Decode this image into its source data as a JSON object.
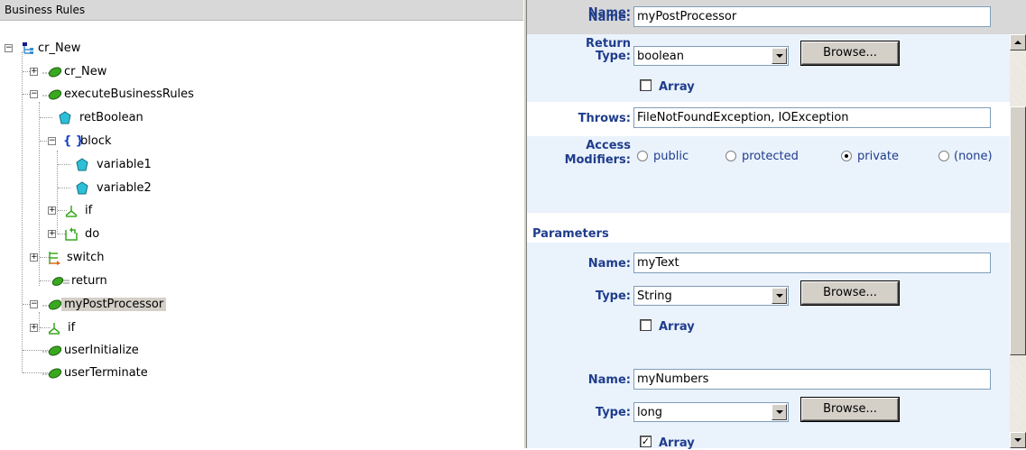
{
  "left_pane": {
    "header": "Business Rules",
    "tree": [
      {
        "label": "cr_New",
        "icon": "class-icon"
      },
      {
        "label": "cr_New",
        "icon": "method-icon"
      },
      {
        "label": "executeBusinessRules",
        "icon": "method-icon"
      },
      {
        "label": "retBoolean",
        "icon": "variable-icon"
      },
      {
        "label": "block",
        "icon": "block-icon",
        "icon_text": "{ }"
      },
      {
        "label": "variable1",
        "icon": "variable-icon"
      },
      {
        "label": "variable2",
        "icon": "variable-icon"
      },
      {
        "label": "if",
        "icon": "if-icon"
      },
      {
        "label": "do",
        "icon": "do-icon"
      },
      {
        "label": "switch",
        "icon": "switch-icon"
      },
      {
        "label": "return",
        "icon": "return-icon"
      },
      {
        "label": "myPostProcessor",
        "icon": "method-icon",
        "selected": true
      },
      {
        "label": "if",
        "icon": "if-icon"
      },
      {
        "label": "userInitialize",
        "icon": "method-icon"
      },
      {
        "label": "userTerminate",
        "icon": "method-icon"
      }
    ]
  },
  "method": {
    "name_label": "Name:",
    "name_value": "myPostProcessor",
    "return_type_label_1": "Return",
    "return_type_label_2": "Type:",
    "return_type_value": "boolean",
    "browse_label": "Browse...",
    "array_label": "Array",
    "array_checked": false,
    "throws_label": "Throws:",
    "throws_value": "FileNotFoundException, IOException",
    "access_label_1": "Access",
    "access_label_2": "Modifiers:",
    "access_options": [
      "public",
      "protected",
      "private",
      "(none)"
    ],
    "access_selected": "private"
  },
  "parameters": {
    "section_label": "Parameters",
    "items": [
      {
        "name_label": "Name:",
        "name": "myText",
        "type_label": "Type:",
        "type": "String",
        "browse_label": "Browse...",
        "array_label": "Array",
        "array_checked": false
      },
      {
        "name_label": "Name:",
        "name": "myNumbers",
        "type_label": "Type:",
        "type": "long",
        "browse_label": "Browse...",
        "array_label": "Array",
        "array_checked": true
      }
    ]
  },
  "colors": {
    "label_blue": "#1f3d8c",
    "band_bg": "#eaf2fc",
    "method_icon": "#2d8a1e",
    "variable_icon": "#1aa3b8"
  }
}
